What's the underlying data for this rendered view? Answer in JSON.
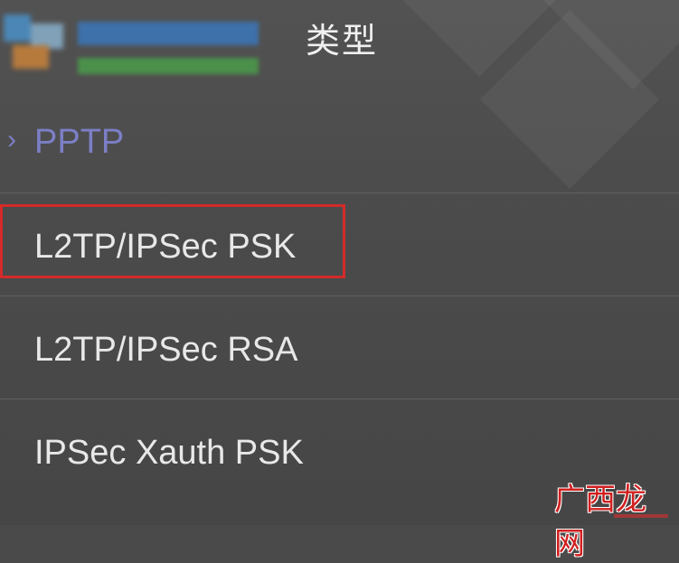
{
  "header": {
    "title": "类型"
  },
  "list": {
    "items": [
      {
        "label": "PPTP",
        "selected": true
      },
      {
        "label": "L2TP/IPSec PSK",
        "selected": false
      },
      {
        "label": "L2TP/IPSec RSA",
        "selected": false
      },
      {
        "label": "IPSec Xauth PSK",
        "selected": false
      }
    ]
  },
  "colors": {
    "background": "#4a4a4a",
    "selected_text": "#7c7fc6",
    "text": "#e8e8e8",
    "highlight_box": "#d42a2a"
  },
  "icons": {
    "selected_marker": "chevron-right-icon"
  },
  "watermark": {
    "corner_text": "广西龙网"
  }
}
